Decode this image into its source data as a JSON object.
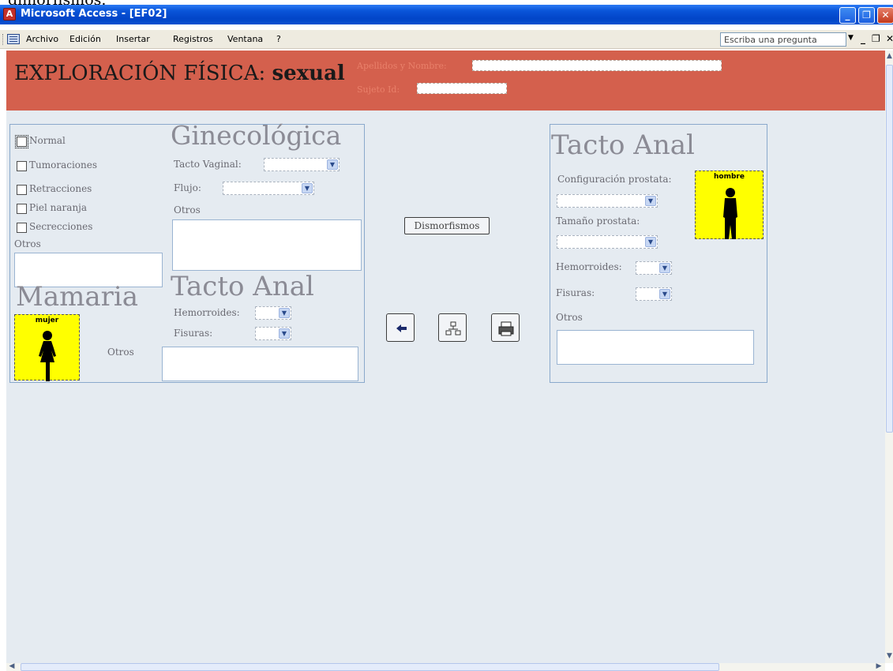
{
  "page_caption": "dimorfismos.",
  "window": {
    "title": "Microsoft Access - [EF02]",
    "minimize_label": "_",
    "restore_label": "❐",
    "close_label": "✕"
  },
  "menu": {
    "items": [
      "Archivo",
      "Edición",
      "Insertar",
      "Registros",
      "Ventana",
      "?"
    ],
    "ask_placeholder": "Escriba una pregunta",
    "mdi_controls": [
      "_",
      "❐",
      "✕"
    ]
  },
  "header": {
    "title_part1": "EXPLORACIÓN FÍSICA:",
    "title_part2": "sexual",
    "name_label": "Apellidos y Nombre:",
    "name_value": "",
    "subject_label": "Sujeto Id:",
    "subject_value": ""
  },
  "mamaria": {
    "heading": "Mamaria",
    "checkboxes": [
      "Normal",
      "Tumoraciones",
      "Retracciones",
      "Piel naranja",
      "Secrecciones"
    ],
    "otros_label": "Otros",
    "otros2_label": "Otros",
    "image_label": "mujer"
  },
  "ginecologica": {
    "heading": "Ginecológica",
    "tacto_vaginal_label": "Tacto Vaginal:",
    "flujo_label": "Flujo:",
    "otros_label": "Otros"
  },
  "tacto_anal_left": {
    "heading": "Tacto Anal",
    "hemorroides_label": "Hemorroides:",
    "fisuras_label": "Fisuras:"
  },
  "center": {
    "dismorfismos_label": "Dismorfismos"
  },
  "tacto_anal_right": {
    "heading": "Tacto Anal",
    "configuracion_label": "Configuración prostata:",
    "tamano_label": "Tamaño prostata:",
    "hemorroides_label": "Hemorroides:",
    "fisuras_label": "Fisuras:",
    "otros_label": "Otros",
    "image_label": "hombre"
  },
  "icons": {
    "back": "arrow-left-icon",
    "tree": "tree-icon",
    "print": "printer-icon",
    "dropdown": "chevron-down-icon"
  }
}
